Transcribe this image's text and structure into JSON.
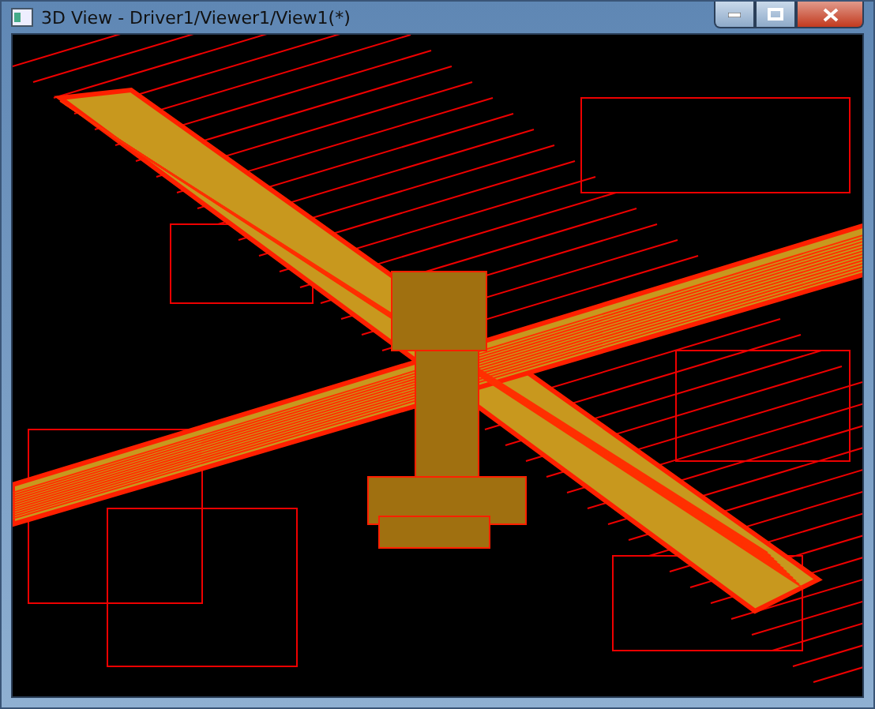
{
  "window": {
    "title": "3D View - Driver1/Viewer1/View1(*)"
  }
}
